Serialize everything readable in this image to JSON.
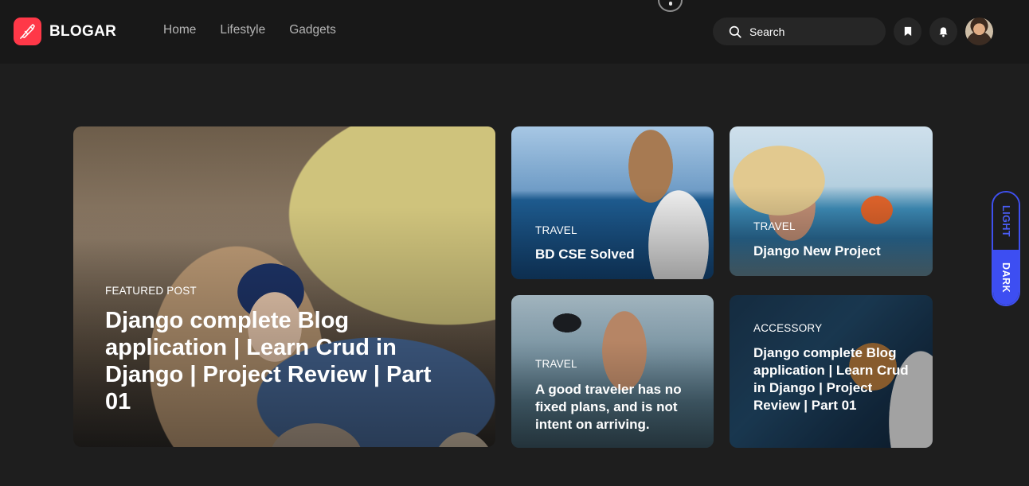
{
  "brand": {
    "name": "BLOGAR",
    "accent": "#ff3848"
  },
  "nav": {
    "items": [
      {
        "label": "Home"
      },
      {
        "label": "Lifestyle"
      },
      {
        "label": "Gadgets"
      }
    ]
  },
  "search": {
    "placeholder": "Search",
    "value": ""
  },
  "icons": {
    "search": "search-icon",
    "bookmark": "bookmark-icon",
    "bell": "bell-icon"
  },
  "posts": {
    "featured": {
      "category": "FEATURED POST",
      "title": "Django complete Blog application | Learn Crud in Django | Project Review | Part 01"
    },
    "cards": [
      {
        "category": "TRAVEL",
        "title": "BD CSE Solved"
      },
      {
        "category": "TRAVEL",
        "title": "Django New Project"
      },
      {
        "category": "TRAVEL",
        "title": "A good traveler has no fixed plans, and is not intent on arriving."
      },
      {
        "category": "ACCESSORY",
        "title": "Django complete Blog application | Learn Crud in Django | Project Review | Part 01"
      }
    ]
  },
  "theme_toggle": {
    "light_label": "LIGHT",
    "dark_label": "DARK",
    "active": "dark",
    "active_color": "#3d4ef2"
  }
}
